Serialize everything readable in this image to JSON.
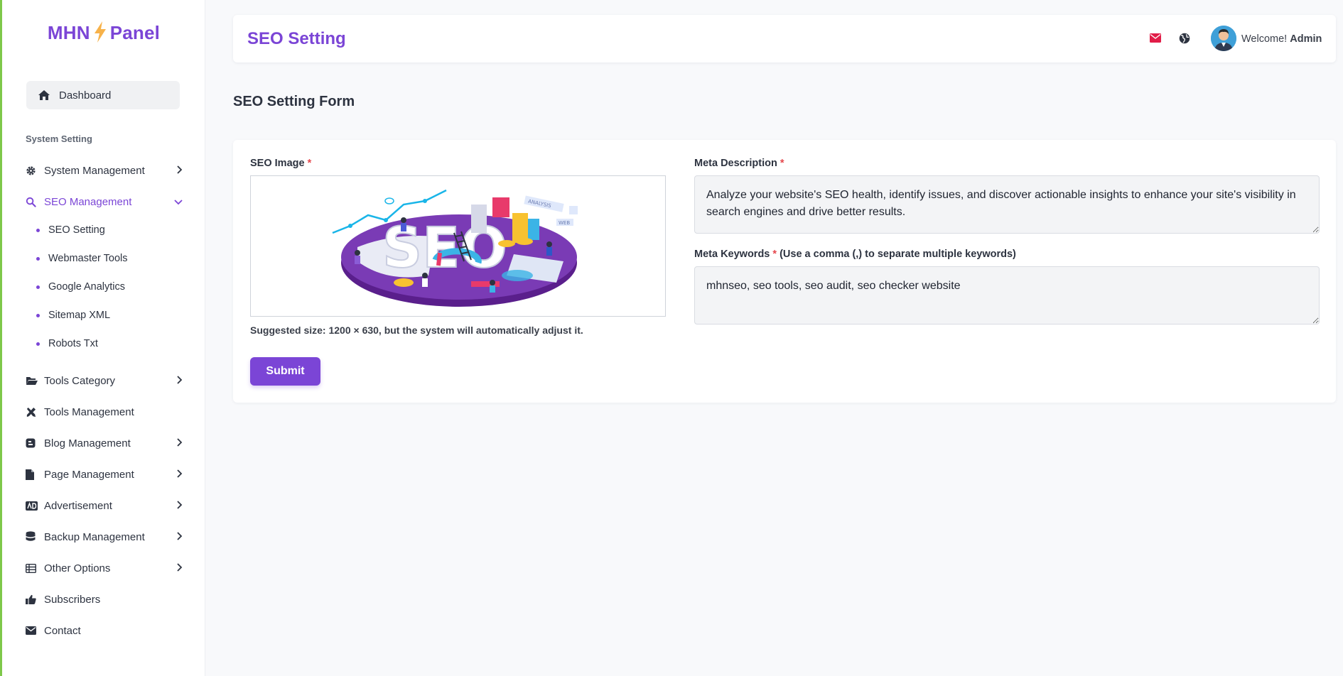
{
  "brand": {
    "left": "MHN",
    "right": "Panel"
  },
  "sidebar": {
    "dashboard": "Dashboard",
    "section_label": "System Setting",
    "items": [
      {
        "label": "System Management",
        "icon": "gear-icon"
      },
      {
        "label": "SEO Management",
        "icon": "search-icon"
      },
      {
        "label": "Tools Category",
        "icon": "folder-open-icon"
      },
      {
        "label": "Tools Management",
        "icon": "tools-icon"
      },
      {
        "label": "Blog Management",
        "icon": "blog-icon"
      },
      {
        "label": "Page Management",
        "icon": "file-icon"
      },
      {
        "label": "Advertisement",
        "icon": "ad-icon"
      },
      {
        "label": "Backup Management",
        "icon": "database-icon"
      },
      {
        "label": "Other Options",
        "icon": "table-icon"
      },
      {
        "label": "Subscribers",
        "icon": "thumbs-up-icon"
      },
      {
        "label": "Contact",
        "icon": "envelope-icon"
      }
    ],
    "seo_sub": [
      "SEO Setting",
      "Webmaster Tools",
      "Google Analytics",
      "Sitemap XML",
      "Robots Txt"
    ]
  },
  "header": {
    "title": "SEO Setting",
    "welcome_prefix": "Welcome!",
    "welcome_user": "Admin"
  },
  "page": {
    "heading": "SEO Setting Form"
  },
  "form": {
    "seo_image_label": "SEO Image",
    "required_mark": "*",
    "image_hint": "Suggested size: 1200 × 630, but the system will automatically adjust it.",
    "meta_description_label": "Meta Description",
    "meta_description_value": "Analyze your website's SEO health, identify issues, and discover actionable insights to enhance your site's visibility in search engines and drive better results.",
    "meta_keywords_label": "Meta Keywords",
    "meta_keywords_note": "(Use a comma (,) to separate multiple keywords)",
    "meta_keywords_value": "mhnseo, seo tools, seo audit, seo checker website",
    "submit_label": "Submit",
    "illustration_words": {
      "main": "SEO",
      "tag1": "ANALYSIS",
      "tag2": "WEB"
    }
  },
  "colors": {
    "accent": "#7b45d6",
    "required": "#e5484d",
    "mail_icon": "#e11d48",
    "left_bar": "#7ec84a"
  }
}
